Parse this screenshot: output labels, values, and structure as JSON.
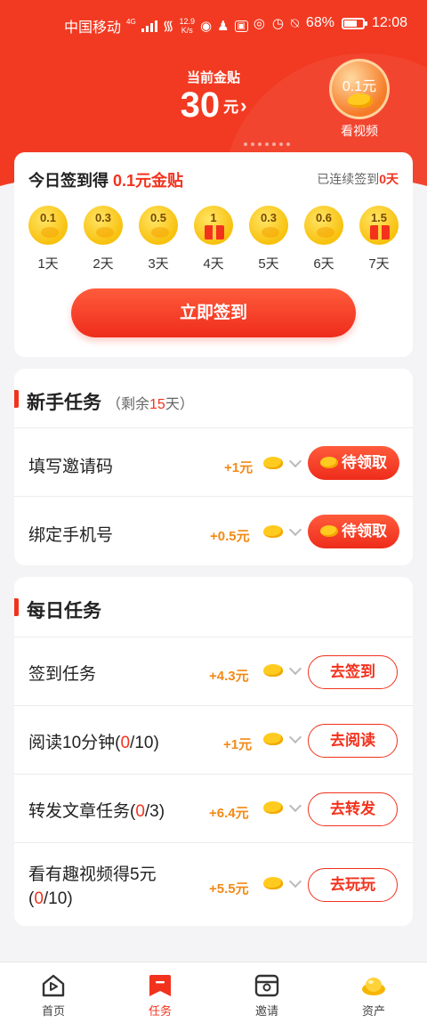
{
  "status_bar": {
    "carrier": "中国移动",
    "network": "4G",
    "net_speed_value": "12.9",
    "net_speed_unit": "K/s",
    "battery": "68%",
    "time": "12:08"
  },
  "header": {
    "balance_label": "当前金贴",
    "balance_value": "30",
    "balance_unit": "元",
    "video_amount": "0.1元",
    "video_label": "看视频"
  },
  "signin": {
    "title_prefix": "今日签到得",
    "title_amount": "0.1元金贴",
    "streak_prefix": "已连续签到",
    "streak_value": "0天",
    "button": "立即签到",
    "days": [
      {
        "value": "0.1",
        "label": "1天",
        "icon": "coin"
      },
      {
        "value": "0.3",
        "label": "2天",
        "icon": "coin"
      },
      {
        "value": "0.5",
        "label": "3天",
        "icon": "coin"
      },
      {
        "value": "1",
        "label": "4天",
        "icon": "gift"
      },
      {
        "value": "0.3",
        "label": "5天",
        "icon": "coin"
      },
      {
        "value": "0.6",
        "label": "6天",
        "icon": "coin"
      },
      {
        "value": "1.5",
        "label": "7天",
        "icon": "gift"
      }
    ]
  },
  "newbie": {
    "title": "新手任务",
    "sub_prefix": "（剩余",
    "sub_value": "15",
    "sub_suffix": "天）",
    "tasks": [
      {
        "name": "填写邀请码",
        "reward": "+1元",
        "action": "待领取"
      },
      {
        "name": "绑定手机号",
        "reward": "+0.5元",
        "action": "待领取"
      }
    ]
  },
  "daily": {
    "title": "每日任务",
    "tasks": [
      {
        "name": "签到任务",
        "reward": "+4.3元",
        "action": "去签到"
      },
      {
        "name_prefix": "阅读10分钟(",
        "progress": "0",
        "name_suffix": "/10)",
        "reward": "+1元",
        "action": "去阅读"
      },
      {
        "name_prefix": "转发文章任务(",
        "progress": "0",
        "name_suffix": "/3)",
        "reward": "+6.4元",
        "action": "去转发"
      },
      {
        "name_line1": "看有趣视频得5元",
        "name_prefix": "(",
        "progress": "0",
        "name_suffix": "/10)",
        "reward": "+5.5元",
        "action": "去玩玩"
      }
    ]
  },
  "tabbar": {
    "items": [
      {
        "label": "首页",
        "icon": "home-play-icon"
      },
      {
        "label": "任务",
        "icon": "task-bookmark-icon",
        "active": true
      },
      {
        "label": "邀请",
        "icon": "invite-envelope-icon"
      },
      {
        "label": "资产",
        "icon": "gold-ingot-icon"
      }
    ]
  },
  "colors": {
    "brand_red": "#f23a22",
    "reward_orange": "#f28a16",
    "gold": "#ffcb1f"
  }
}
